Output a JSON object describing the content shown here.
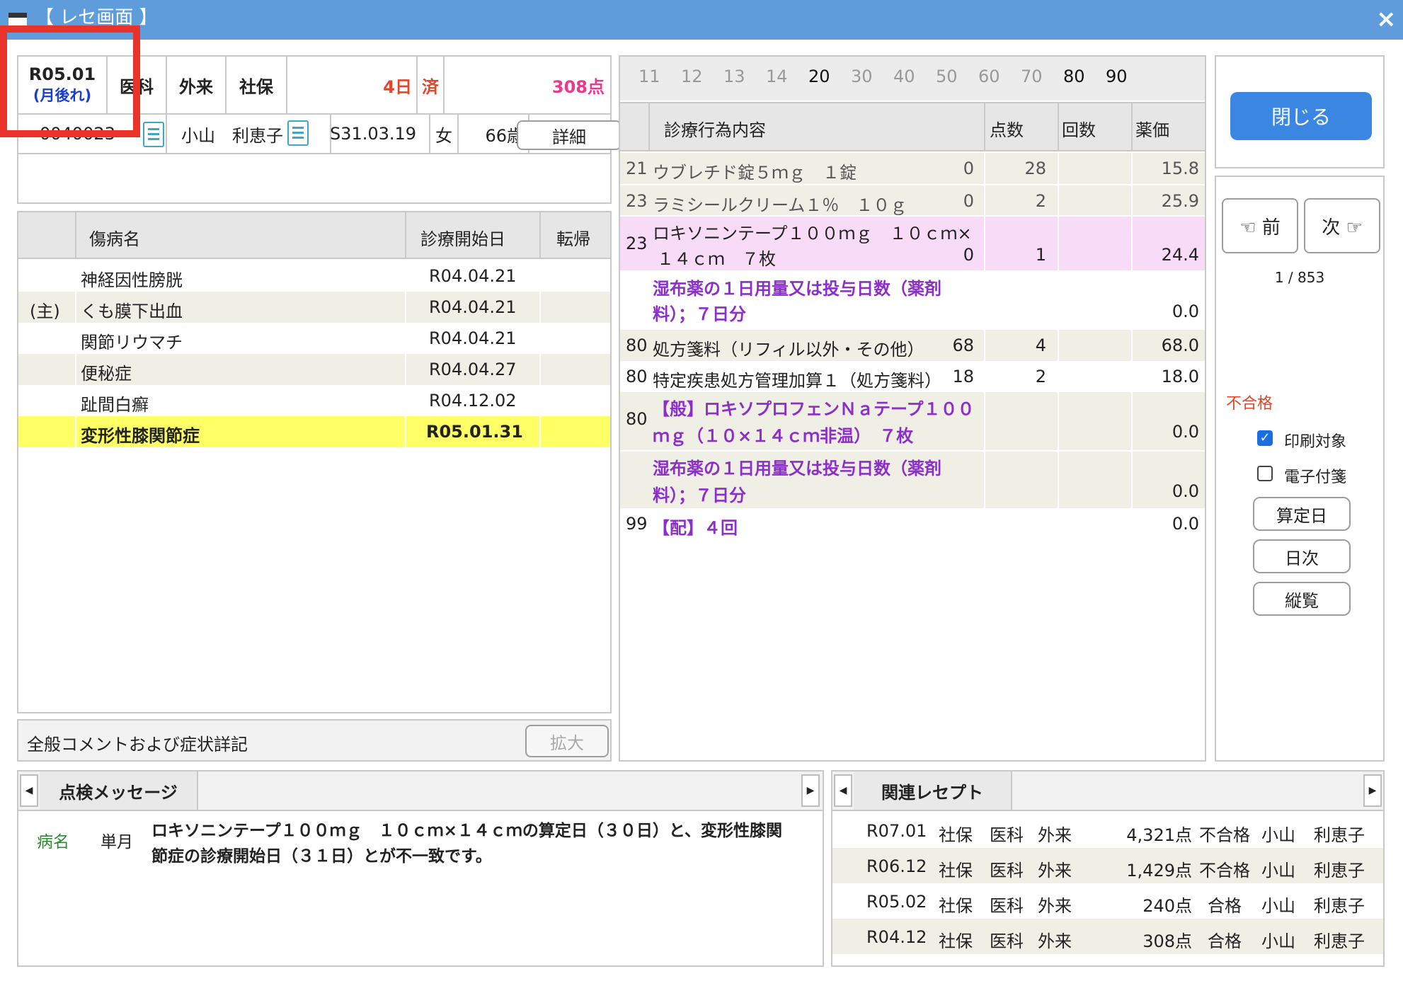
{
  "window": {
    "title": "【 レセ画面 】",
    "close_glyph": "×"
  },
  "header": {
    "year_month": "R05.01",
    "late_note": "(月後れ)",
    "dept": "医科",
    "visit_type": "外来",
    "insurance": "社保",
    "days": "4日",
    "done": "済",
    "points": "308点",
    "patient_id": "0040023",
    "patient_name": "小山　利恵子",
    "birth_date": "S31.03.19",
    "sex": "女",
    "age": "66歳",
    "detail_button": "詳細"
  },
  "diagnosis": {
    "columns": [
      "",
      "傷病名",
      "診療開始日",
      "転帰"
    ],
    "rows": [
      {
        "mark": "",
        "name": "神経因性膀胱",
        "start": "R04.04.21",
        "outcome": ""
      },
      {
        "mark": "(主)",
        "name": "くも膜下出血",
        "start": "R04.04.21",
        "outcome": ""
      },
      {
        "mark": "",
        "name": "関節リウマチ",
        "start": "R04.04.21",
        "outcome": ""
      },
      {
        "mark": "",
        "name": "便秘症",
        "start": "R04.04.27",
        "outcome": ""
      },
      {
        "mark": "",
        "name": "趾間白癬",
        "start": "R04.12.02",
        "outcome": ""
      },
      {
        "mark": "",
        "name": "変形性膝関節症",
        "start": "R05.01.31",
        "outcome": ""
      }
    ],
    "comment_label": "全般コメントおよび症状詳記",
    "expand_button": "拡大"
  },
  "treatment": {
    "tabs": [
      "11",
      "12",
      "13",
      "14",
      "20",
      "30",
      "40",
      "50",
      "60",
      "70",
      "80",
      "90"
    ],
    "active_tabs": [
      "20",
      "80",
      "90"
    ],
    "columns": [
      "診療行為内容",
      "点数",
      "回数",
      "薬価"
    ],
    "rows": [
      {
        "code": "21",
        "line1": "ウブレチド錠５ｍｇ　１錠",
        "line2": "",
        "points": "0",
        "count": "28",
        "price": "15.8"
      },
      {
        "code": "23",
        "line1": "ラミシールクリーム１％　１０ｇ",
        "line2": "",
        "points": "0",
        "count": "2",
        "price": "25.9"
      },
      {
        "code": "23",
        "line1": "ロキソニンテープ１００ｍｇ　１０ｃｍ×",
        "line2": "１４ｃｍ　７枚",
        "points": "0",
        "count": "1",
        "price": "24.4"
      },
      {
        "code": "",
        "line1": "湿布薬の１日用量又は投与日数（薬剤",
        "line2": "料）；７日分",
        "points": "",
        "count": "",
        "price": "0.0"
      },
      {
        "code": "80",
        "line1": "処方箋料（リフィル以外・その他）",
        "line2": "",
        "points": "68",
        "count": "4",
        "price": "68.0"
      },
      {
        "code": "80",
        "line1": "特定疾患処方管理加算１（処方箋料）",
        "line2": "",
        "points": "18",
        "count": "2",
        "price": "18.0"
      },
      {
        "code": "80",
        "line1": "【般】ロキソプロフェンＮａテープ１００",
        "line2": "ｍｇ（１０×１４ｃｍ非温）　７枚",
        "points": "",
        "count": "",
        "price": "0.0"
      },
      {
        "code": "",
        "line1": "湿布薬の１日用量又は投与日数（薬剤",
        "line2": "料）；７日分",
        "points": "",
        "count": "",
        "price": "0.0"
      },
      {
        "code": "99",
        "line1": "【配】４回",
        "line2": "",
        "points": "",
        "count": "",
        "price": "0.0"
      }
    ]
  },
  "sidebar": {
    "close_button": "閉じる",
    "prev_button": "☜ 前",
    "next_button": "次 ☞",
    "pager": "1 / 853",
    "status": "不合格",
    "print_label": "印刷対象",
    "print_checked": true,
    "esign_label": "電子付箋",
    "esign_checked": false,
    "calc_date_button": "算定日",
    "daily_button": "日次",
    "vertical_button": "縦覧"
  },
  "check_messages": {
    "tab_label": "点検メッセージ",
    "items": [
      {
        "category": "病名",
        "scope": "単月",
        "text_line1": "ロキソニンテープ１００ｍｇ　１０ｃｍ×１４ｃｍの算定日（３０日）と、変形性膝関",
        "text_line2": "節症の診療開始日（３１日）とが不一致です。"
      }
    ]
  },
  "related": {
    "tab_label": "関連レセプト",
    "rows": [
      {
        "ym": "R07.01",
        "ins": "社保",
        "dept": "医科",
        "type": "外来",
        "points": "4,321点",
        "result": "不合格",
        "last": "小山",
        "first": "利恵子"
      },
      {
        "ym": "R06.12",
        "ins": "社保",
        "dept": "医科",
        "type": "外来",
        "points": "1,429点",
        "result": "不合格",
        "last": "小山",
        "first": "利恵子"
      },
      {
        "ym": "R05.02",
        "ins": "社保",
        "dept": "医科",
        "type": "外来",
        "points": "240点",
        "result": "合格",
        "last": "小山",
        "first": "利恵子"
      },
      {
        "ym": "R04.12",
        "ins": "社保",
        "dept": "医科",
        "type": "外来",
        "points": "308点",
        "result": "合格",
        "last": "小山",
        "first": "利恵子"
      }
    ]
  },
  "colors": {
    "titlebar": "#5e9cdc",
    "accent_button": "#3a86e0",
    "purple_text": "#8b2fc9",
    "highlight_row": "#ffff66",
    "pink_row": "#f7dbf7",
    "red_status": "#e2462a",
    "points_pink": "#e83a8c",
    "annotation_box": "#e8322a"
  }
}
